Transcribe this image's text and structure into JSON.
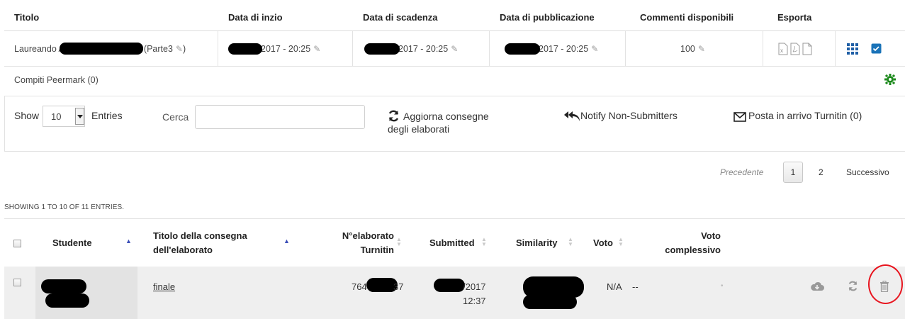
{
  "assignment_table": {
    "headers": {
      "title": "Titolo",
      "start": "Data di inzio",
      "due": "Data di scadenza",
      "post": "Data di pubblicazione",
      "marks": "Commenti disponibili",
      "export": "Esporta"
    },
    "row": {
      "title_prefix": "Laureando A",
      "title_suffix": "(Parte3",
      "title_close": ")",
      "start": "2017 - 20:25",
      "due": "2017 - 20:25",
      "post": "2017 - 20:25",
      "marks": "100"
    },
    "peermark_label": "Compiti Peermark (0)"
  },
  "controls": {
    "show_label": "Show",
    "entries_value": "10",
    "entries_label": "Entries",
    "search_label": "Cerca",
    "search_value": "",
    "refresh_line1": "Aggiorna consegne",
    "refresh_line2": "degli elaborati",
    "notify_label": "Notify Non-Submitters",
    "inbox_label": "Posta in arrivo Turnitin (0)"
  },
  "pagination": {
    "prev": "Precedente",
    "pages": [
      "1",
      "2"
    ],
    "next": "Successivo"
  },
  "showing_text": "SHOWING 1 TO 10 OF 11 ENTRIES.",
  "submissions": {
    "headers": {
      "student": "Studente",
      "title_line1": "Titolo della consegna",
      "title_line2": "dell'elaborato",
      "paper_line1": "N°elaborato",
      "paper_line2": "Turnitin",
      "submitted": "Submitted",
      "similarity": "Similarity",
      "grade": "Voto",
      "overall_line1": "Voto",
      "overall_line2": "complessivo"
    },
    "rows": [
      {
        "title": "finale",
        "paper_prefix": "764",
        "paper_suffix": "37",
        "submitted_date": "/2017",
        "submitted_time": "12:37",
        "grade": "N/A",
        "overall": "--",
        "dot": "•"
      }
    ]
  },
  "colors": {
    "highlight_ring": "#e8141e",
    "checkbox_blue": "#1a73b8",
    "gear_green": "#1d8a1d",
    "grid_blue": "#1f5fa6"
  }
}
